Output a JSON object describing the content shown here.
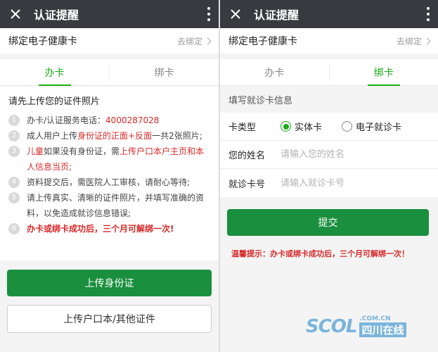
{
  "left": {
    "title": "认证提醒",
    "bind_row": {
      "label": "绑定电子健康卡",
      "action": "去绑定"
    },
    "tabs": [
      "办卡",
      "绑卡"
    ],
    "heading": "请先上传您的证件照片",
    "steps": [
      {
        "num": "1",
        "t1": "办卡/认证服务电话：",
        "phone": "4000287028"
      },
      {
        "num": "2",
        "t1": "成人用户上传",
        "r1": "身份证的正面+反面",
        "t2": "一共2张照片;"
      },
      {
        "num": "3",
        "r1": "儿童",
        "t1": "如果没有身份证，需",
        "r2": "上传户口本户主页和本人信息当页",
        "t2": ";"
      },
      {
        "num": "4",
        "t1": "资料提交后，需医院人工审核，请耐心等待;"
      },
      {
        "num": "5",
        "t1": "请上传真实、清晰的证件照片，并填写准确的资料，以免造成就诊信息错误;"
      },
      {
        "num": "6",
        "r1": "办卡或绑卡成功后，三个月可解绑一次!"
      }
    ],
    "upload_id_button": "上传身份证",
    "upload_other_button": "上传户口本/其他证件"
  },
  "right": {
    "title": "认证提醒",
    "bind_row": {
      "label": "绑定电子健康卡",
      "action": "去绑定"
    },
    "tabs": [
      "办卡",
      "绑卡"
    ],
    "section_label": "填写就诊卡信息",
    "card_type": {
      "label": "卡类型",
      "options": [
        "实体卡",
        "电子就诊卡"
      ],
      "selected": "实体卡"
    },
    "name_field": {
      "label": "您的姓名",
      "placeholder": "请输入您的姓名",
      "value": ""
    },
    "card_no_field": {
      "label": "就诊卡号",
      "placeholder": "请输入就诊卡号",
      "value": ""
    },
    "submit_button": "提交",
    "tip": "温馨提示：办卡或绑卡成功后，三个月可解绑一次！"
  },
  "watermark": {
    "brand": "SCOL",
    "domain": ".COM.CN",
    "name": "四川在线"
  },
  "colors": {
    "accent": "#1aad19",
    "button": "#1a8f3e",
    "titlebar": "#393a3f",
    "warning": "#d62a2a"
  },
  "icons": [
    "close-icon",
    "more-icon",
    "chevron-right-icon",
    "radio-icon"
  ]
}
